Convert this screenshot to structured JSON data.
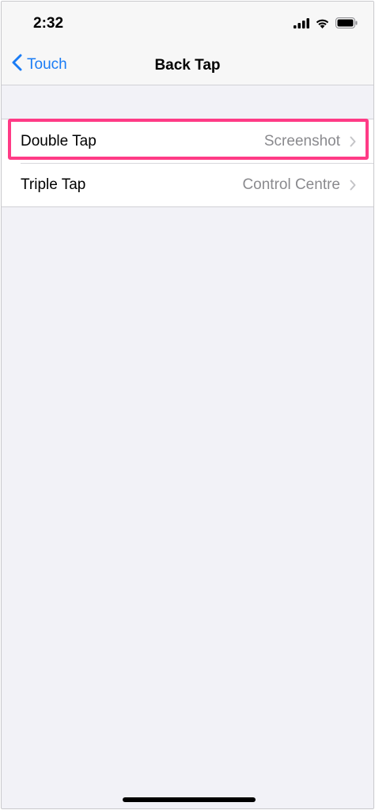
{
  "status_bar": {
    "time": "2:32",
    "icons": [
      "cellular-signal-icon",
      "wifi-icon",
      "battery-icon"
    ]
  },
  "nav": {
    "back_label": "Touch",
    "title": "Back Tap"
  },
  "rows": [
    {
      "label": "Double Tap",
      "value": "Screenshot",
      "highlighted": true
    },
    {
      "label": "Triple Tap",
      "value": "Control Centre",
      "highlighted": false
    }
  ],
  "colors": {
    "accent": "#1a7cf5",
    "highlight": "#ff3b86",
    "background": "#f2f2f7",
    "secondary_text": "#8a8a8e"
  }
}
